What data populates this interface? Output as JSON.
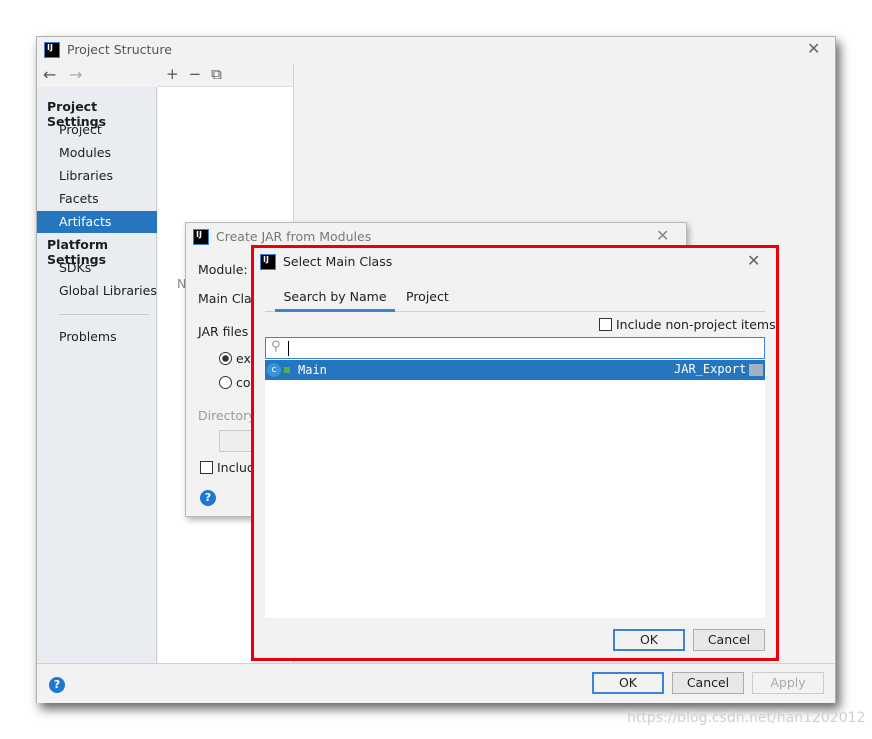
{
  "project_structure": {
    "title": "Project Structure",
    "sidebar": {
      "project_settings_heading": "Project Settings",
      "project_items": [
        "Project",
        "Modules",
        "Libraries",
        "Facets",
        "Artifacts"
      ],
      "selected": "Artifacts",
      "platform_settings_heading": "Platform Settings",
      "platform_items": [
        "SDKs",
        "Global Libraries"
      ],
      "problems": "Problems"
    },
    "toolbar": {
      "add": "+",
      "remove": "−",
      "copy": "⧉"
    },
    "nothing_partial": "N",
    "ok": "OK",
    "cancel": "Cancel",
    "apply": "Apply"
  },
  "create_jar": {
    "title": "Create JAR from Modules",
    "module_label": "Module:",
    "main_class_label": "Main Clas",
    "jar_files_label": "JAR files",
    "radio_extract": "ext",
    "radio_copy": "co",
    "directory_label": "Directory",
    "include_label": "Includ"
  },
  "select_main_class": {
    "title": "Select Main Class",
    "tabs": [
      "Search by Name",
      "Project"
    ],
    "active_tab": "Search by Name",
    "include_non_project": "Include non-project items",
    "search_value": "",
    "results": [
      {
        "name": "Main",
        "module": "JAR_Export",
        "selected": true
      }
    ],
    "ok": "OK",
    "cancel": "Cancel"
  },
  "watermark": "https://blog.csdn.net/han1202012",
  "colors": {
    "selection": "#2675bf",
    "highlight_border": "#e8000b",
    "focus": "#3c83d6"
  }
}
